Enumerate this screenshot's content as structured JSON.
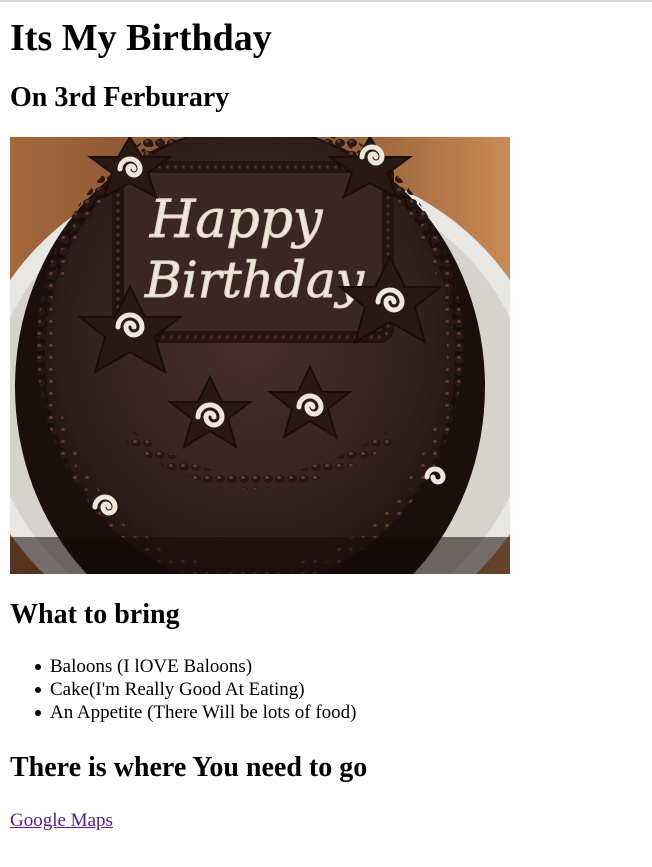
{
  "title": "Its My Birthday",
  "date_heading": "On 3rd Ferburary",
  "image": {
    "icon": "birthday-cake-image",
    "inscription_line1": "Happy",
    "inscription_line2": "Birthday"
  },
  "bring": {
    "heading": "What to bring",
    "items": [
      "Baloons (I lOVE Baloons)",
      "Cake(I'm Really Good At Eating)",
      "An Appetite (There Will be lots of food)"
    ]
  },
  "directions": {
    "heading": "There is where You need to go",
    "link_label": "Google Maps"
  },
  "colors": {
    "link": "#551a8b",
    "chocolate": "#3a2520",
    "icing": "#f2ece0"
  }
}
